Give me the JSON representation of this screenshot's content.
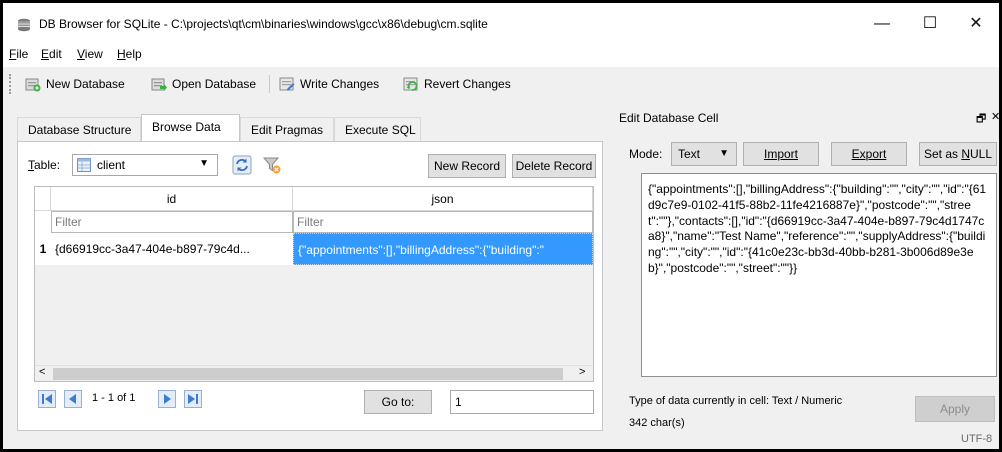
{
  "window": {
    "title": "DB Browser for SQLite - C:\\projects\\qt\\cm\\binaries\\windows\\gcc\\x86\\debug\\cm.sqlite",
    "minimize_glyph": "—",
    "maximize_glyph": "☐",
    "close_glyph": "✕"
  },
  "menu": [
    {
      "u": "F",
      "rest": "ile"
    },
    {
      "u": "E",
      "rest": "dit"
    },
    {
      "u": "V",
      "rest": "iew"
    },
    {
      "u": "H",
      "rest": "elp"
    }
  ],
  "toolbar": {
    "new_database": "New Database",
    "open_database": "Open Database",
    "write_changes": "Write Changes",
    "revert_changes": "Revert Changes"
  },
  "tabs": [
    "Database Structure",
    "Browse Data",
    "Edit Pragmas",
    "Execute SQL"
  ],
  "browse": {
    "table_label_u": "T",
    "table_label_rest": "able:",
    "table_value": "client",
    "new_record": "New Record",
    "delete_record": "Delete Record",
    "columns": [
      "id",
      "json"
    ],
    "filter_placeholder": "Filter",
    "row_number": "1",
    "row_id": "{d66919cc-3a47-404e-b897-79c4d...",
    "row_json": "{\"appointments\":[],\"billingAddress\":{\"building\":\"",
    "scroll_left": "<",
    "scroll_right": ">",
    "record_range": "1 - 1 of 1",
    "goto_label": "Go to:",
    "goto_value": "1"
  },
  "edit_cell": {
    "title": "Edit Database Cell",
    "float_glyph": "🗗",
    "close_glyph": "✕",
    "mode_label": "Mode:",
    "mode_value": "Text",
    "import": "Import",
    "export": "Export",
    "set_null_prefix": "Set as ",
    "set_null_u": "N",
    "set_null_rest": "ULL",
    "content": "{\"appointments\":[],\"billingAddress\":{\"building\":\"\",\"city\":\"\",\"id\":\"{61d9c7e9-0102-41f5-88b2-11fe4216887e}\",\"postcode\":\"\",\"street\":\"\"},\"contacts\":[],\"id\":\"{d66919cc-3a47-404e-b897-79c4d1747ca8}\",\"name\":\"Test Name\",\"reference\":\"\",\"supplyAddress\":{\"building\":\"\",\"city\":\"\",\"id\":\"{41c0e23c-bb3d-40bb-b281-3b006d89e3eb}\",\"postcode\":\"\",\"street\":\"\"}}",
    "type_info": "Type of data currently in cell: Text / Numeric",
    "char_count": "342 char(s)",
    "apply": "Apply"
  },
  "statusbar": {
    "encoding": "UTF-8"
  },
  "colors": {
    "selection": "#3399ff",
    "nav_blue": "#3a7bd5",
    "window_bg": "#f0f0f0"
  }
}
